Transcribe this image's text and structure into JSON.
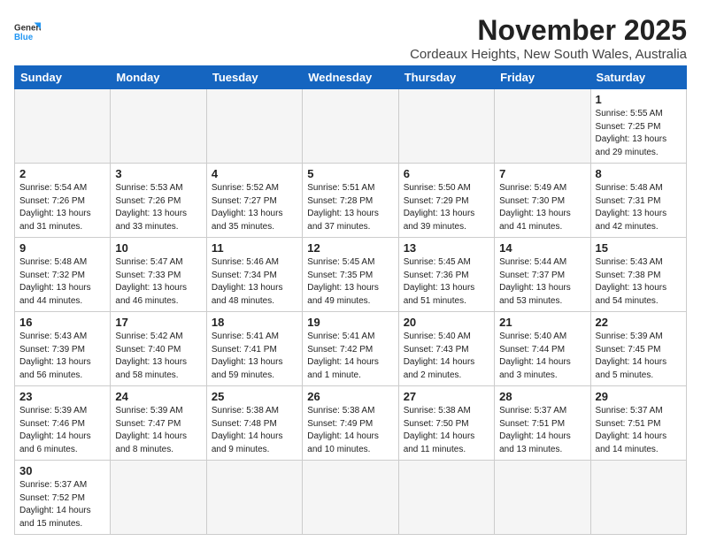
{
  "logo": {
    "line1": "General",
    "line2": "Blue"
  },
  "title": "November 2025",
  "location": "Cordeaux Heights, New South Wales, Australia",
  "weekdays": [
    "Sunday",
    "Monday",
    "Tuesday",
    "Wednesday",
    "Thursday",
    "Friday",
    "Saturday"
  ],
  "weeks": [
    [
      {
        "day": "",
        "info": ""
      },
      {
        "day": "",
        "info": ""
      },
      {
        "day": "",
        "info": ""
      },
      {
        "day": "",
        "info": ""
      },
      {
        "day": "",
        "info": ""
      },
      {
        "day": "",
        "info": ""
      },
      {
        "day": "1",
        "info": "Sunrise: 5:55 AM\nSunset: 7:25 PM\nDaylight: 13 hours\nand 29 minutes."
      }
    ],
    [
      {
        "day": "2",
        "info": "Sunrise: 5:54 AM\nSunset: 7:26 PM\nDaylight: 13 hours\nand 31 minutes."
      },
      {
        "day": "3",
        "info": "Sunrise: 5:53 AM\nSunset: 7:26 PM\nDaylight: 13 hours\nand 33 minutes."
      },
      {
        "day": "4",
        "info": "Sunrise: 5:52 AM\nSunset: 7:27 PM\nDaylight: 13 hours\nand 35 minutes."
      },
      {
        "day": "5",
        "info": "Sunrise: 5:51 AM\nSunset: 7:28 PM\nDaylight: 13 hours\nand 37 minutes."
      },
      {
        "day": "6",
        "info": "Sunrise: 5:50 AM\nSunset: 7:29 PM\nDaylight: 13 hours\nand 39 minutes."
      },
      {
        "day": "7",
        "info": "Sunrise: 5:49 AM\nSunset: 7:30 PM\nDaylight: 13 hours\nand 41 minutes."
      },
      {
        "day": "8",
        "info": "Sunrise: 5:48 AM\nSunset: 7:31 PM\nDaylight: 13 hours\nand 42 minutes."
      }
    ],
    [
      {
        "day": "9",
        "info": "Sunrise: 5:48 AM\nSunset: 7:32 PM\nDaylight: 13 hours\nand 44 minutes."
      },
      {
        "day": "10",
        "info": "Sunrise: 5:47 AM\nSunset: 7:33 PM\nDaylight: 13 hours\nand 46 minutes."
      },
      {
        "day": "11",
        "info": "Sunrise: 5:46 AM\nSunset: 7:34 PM\nDaylight: 13 hours\nand 48 minutes."
      },
      {
        "day": "12",
        "info": "Sunrise: 5:45 AM\nSunset: 7:35 PM\nDaylight: 13 hours\nand 49 minutes."
      },
      {
        "day": "13",
        "info": "Sunrise: 5:45 AM\nSunset: 7:36 PM\nDaylight: 13 hours\nand 51 minutes."
      },
      {
        "day": "14",
        "info": "Sunrise: 5:44 AM\nSunset: 7:37 PM\nDaylight: 13 hours\nand 53 minutes."
      },
      {
        "day": "15",
        "info": "Sunrise: 5:43 AM\nSunset: 7:38 PM\nDaylight: 13 hours\nand 54 minutes."
      }
    ],
    [
      {
        "day": "16",
        "info": "Sunrise: 5:43 AM\nSunset: 7:39 PM\nDaylight: 13 hours\nand 56 minutes."
      },
      {
        "day": "17",
        "info": "Sunrise: 5:42 AM\nSunset: 7:40 PM\nDaylight: 13 hours\nand 58 minutes."
      },
      {
        "day": "18",
        "info": "Sunrise: 5:41 AM\nSunset: 7:41 PM\nDaylight: 13 hours\nand 59 minutes."
      },
      {
        "day": "19",
        "info": "Sunrise: 5:41 AM\nSunset: 7:42 PM\nDaylight: 14 hours\nand 1 minute."
      },
      {
        "day": "20",
        "info": "Sunrise: 5:40 AM\nSunset: 7:43 PM\nDaylight: 14 hours\nand 2 minutes."
      },
      {
        "day": "21",
        "info": "Sunrise: 5:40 AM\nSunset: 7:44 PM\nDaylight: 14 hours\nand 3 minutes."
      },
      {
        "day": "22",
        "info": "Sunrise: 5:39 AM\nSunset: 7:45 PM\nDaylight: 14 hours\nand 5 minutes."
      }
    ],
    [
      {
        "day": "23",
        "info": "Sunrise: 5:39 AM\nSunset: 7:46 PM\nDaylight: 14 hours\nand 6 minutes."
      },
      {
        "day": "24",
        "info": "Sunrise: 5:39 AM\nSunset: 7:47 PM\nDaylight: 14 hours\nand 8 minutes."
      },
      {
        "day": "25",
        "info": "Sunrise: 5:38 AM\nSunset: 7:48 PM\nDaylight: 14 hours\nand 9 minutes."
      },
      {
        "day": "26",
        "info": "Sunrise: 5:38 AM\nSunset: 7:49 PM\nDaylight: 14 hours\nand 10 minutes."
      },
      {
        "day": "27",
        "info": "Sunrise: 5:38 AM\nSunset: 7:50 PM\nDaylight: 14 hours\nand 11 minutes."
      },
      {
        "day": "28",
        "info": "Sunrise: 5:37 AM\nSunset: 7:51 PM\nDaylight: 14 hours\nand 13 minutes."
      },
      {
        "day": "29",
        "info": "Sunrise: 5:37 AM\nSunset: 7:51 PM\nDaylight: 14 hours\nand 14 minutes."
      }
    ],
    [
      {
        "day": "30",
        "info": "Sunrise: 5:37 AM\nSunset: 7:52 PM\nDaylight: 14 hours\nand 15 minutes."
      },
      {
        "day": "",
        "info": ""
      },
      {
        "day": "",
        "info": ""
      },
      {
        "day": "",
        "info": ""
      },
      {
        "day": "",
        "info": ""
      },
      {
        "day": "",
        "info": ""
      },
      {
        "day": "",
        "info": ""
      }
    ]
  ]
}
